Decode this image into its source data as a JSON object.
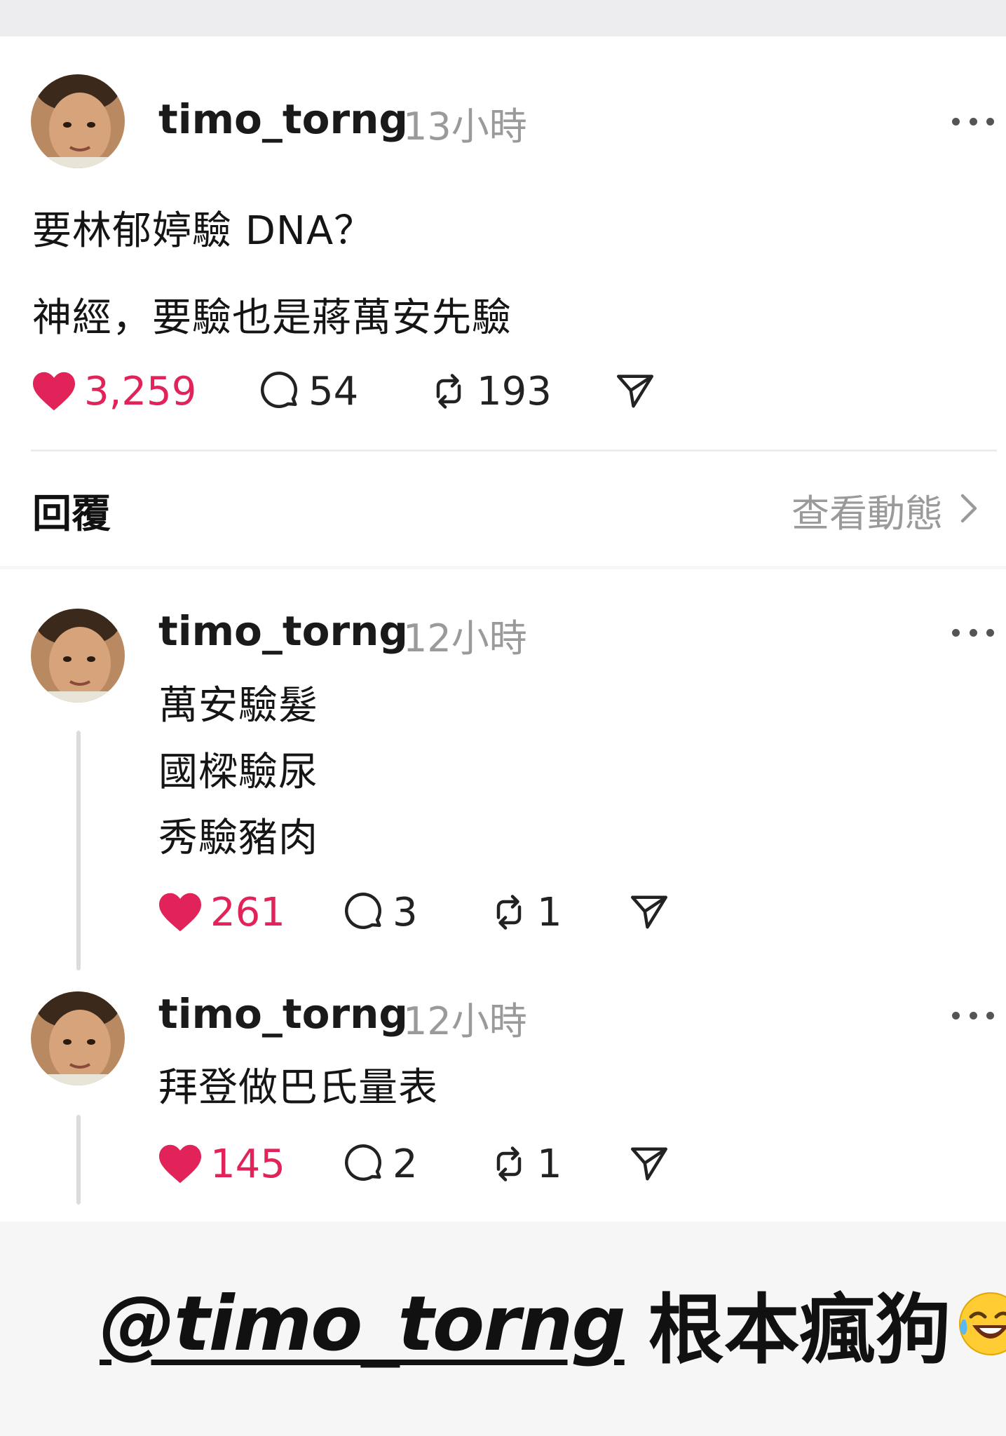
{
  "post": {
    "username": "timo_torng",
    "time": "13小時",
    "lines": [
      "要林郁婷驗 DNA？",
      "神經，要驗也是蔣萬安先驗"
    ],
    "likes": "3,259",
    "comments": "54",
    "reposts": "193"
  },
  "replies_header": {
    "label": "回覆",
    "view_activity": "查看動態"
  },
  "replies": [
    {
      "username": "timo_torng",
      "time": "12小時",
      "lines": [
        "萬安驗髮",
        "國樑驗尿",
        "秀驗豬肉"
      ],
      "likes": "261",
      "comments": "3",
      "reposts": "1"
    },
    {
      "username": "timo_torng",
      "time": "12小時",
      "lines": [
        "拜登做巴氏量表"
      ],
      "likes": "145",
      "comments": "2",
      "reposts": "1"
    }
  ],
  "caption": {
    "mention": "@timo_torng",
    "text": "根本瘋狗",
    "emoji": "laughing-tears-emoji"
  },
  "colors": {
    "like": "#e1235a",
    "muted": "#9a9a9a",
    "text": "#111111"
  }
}
